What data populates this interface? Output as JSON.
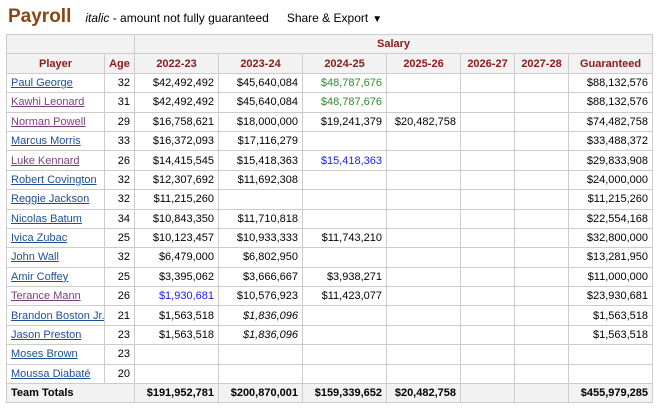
{
  "header": {
    "title": "Payroll",
    "note_italic": "italic",
    "note_rest": " - amount not fully guaranteed",
    "share_label": "Share & Export",
    "share_caret": "▼"
  },
  "table": {
    "group_header": "Salary",
    "columns": [
      "Player",
      "Age",
      "2022-23",
      "2023-24",
      "2024-25",
      "2025-26",
      "2026-27",
      "2027-28",
      "Guaranteed"
    ],
    "rows": [
      {
        "player": "Paul George",
        "visited": false,
        "age": "32",
        "c": [
          {
            "v": "$42,492,492"
          },
          {
            "v": "$45,640,084"
          },
          {
            "v": "$48,787,676",
            "s": "green"
          },
          {
            "v": ""
          },
          {
            "v": ""
          },
          {
            "v": ""
          }
        ],
        "guaranteed": "$88,132,576"
      },
      {
        "player": "Kawhi Leonard",
        "visited": true,
        "age": "31",
        "c": [
          {
            "v": "$42,492,492"
          },
          {
            "v": "$45,640,084"
          },
          {
            "v": "$48,787,676",
            "s": "green"
          },
          {
            "v": ""
          },
          {
            "v": ""
          },
          {
            "v": ""
          }
        ],
        "guaranteed": "$88,132,576"
      },
      {
        "player": "Norman Powell",
        "visited": true,
        "age": "29",
        "c": [
          {
            "v": "$16,758,621"
          },
          {
            "v": "$18,000,000"
          },
          {
            "v": "$19,241,379"
          },
          {
            "v": "$20,482,758"
          },
          {
            "v": ""
          },
          {
            "v": ""
          }
        ],
        "guaranteed": "$74,482,758"
      },
      {
        "player": "Marcus Morris",
        "visited": false,
        "age": "33",
        "c": [
          {
            "v": "$16,372,093"
          },
          {
            "v": "$17,116,279"
          },
          {
            "v": ""
          },
          {
            "v": ""
          },
          {
            "v": ""
          },
          {
            "v": ""
          }
        ],
        "guaranteed": "$33,488,372"
      },
      {
        "player": "Luke Kennard",
        "visited": true,
        "age": "26",
        "c": [
          {
            "v": "$14,415,545"
          },
          {
            "v": "$15,418,363"
          },
          {
            "v": "$15,418,363",
            "s": "blue"
          },
          {
            "v": ""
          },
          {
            "v": ""
          },
          {
            "v": ""
          }
        ],
        "guaranteed": "$29,833,908"
      },
      {
        "player": "Robert Covington",
        "visited": false,
        "age": "32",
        "c": [
          {
            "v": "$12,307,692"
          },
          {
            "v": "$11,692,308"
          },
          {
            "v": ""
          },
          {
            "v": ""
          },
          {
            "v": ""
          },
          {
            "v": ""
          }
        ],
        "guaranteed": "$24,000,000"
      },
      {
        "player": "Reggie Jackson",
        "visited": false,
        "age": "32",
        "c": [
          {
            "v": "$11,215,260"
          },
          {
            "v": ""
          },
          {
            "v": ""
          },
          {
            "v": ""
          },
          {
            "v": ""
          },
          {
            "v": ""
          }
        ],
        "guaranteed": "$11,215,260"
      },
      {
        "player": "Nicolas Batum",
        "visited": false,
        "age": "34",
        "c": [
          {
            "v": "$10,843,350"
          },
          {
            "v": "$11,710,818"
          },
          {
            "v": ""
          },
          {
            "v": ""
          },
          {
            "v": ""
          },
          {
            "v": ""
          }
        ],
        "guaranteed": "$22,554,168"
      },
      {
        "player": "Ivica Zubac",
        "visited": false,
        "age": "25",
        "c": [
          {
            "v": "$10,123,457"
          },
          {
            "v": "$10,933,333"
          },
          {
            "v": "$11,743,210"
          },
          {
            "v": ""
          },
          {
            "v": ""
          },
          {
            "v": ""
          }
        ],
        "guaranteed": "$32,800,000"
      },
      {
        "player": "John Wall",
        "visited": false,
        "age": "32",
        "c": [
          {
            "v": "$6,479,000"
          },
          {
            "v": "$6,802,950"
          },
          {
            "v": ""
          },
          {
            "v": ""
          },
          {
            "v": ""
          },
          {
            "v": ""
          }
        ],
        "guaranteed": "$13,281,950"
      },
      {
        "player": "Amir Coffey",
        "visited": false,
        "age": "25",
        "c": [
          {
            "v": "$3,395,062"
          },
          {
            "v": "$3,666,667"
          },
          {
            "v": "$3,938,271"
          },
          {
            "v": ""
          },
          {
            "v": ""
          },
          {
            "v": ""
          }
        ],
        "guaranteed": "$11,000,000"
      },
      {
        "player": "Terance Mann",
        "visited": true,
        "age": "26",
        "c": [
          {
            "v": "$1,930,681",
            "s": "blue"
          },
          {
            "v": "$10,576,923"
          },
          {
            "v": "$11,423,077"
          },
          {
            "v": ""
          },
          {
            "v": ""
          },
          {
            "v": ""
          }
        ],
        "guaranteed": "$23,930,681"
      },
      {
        "player": "Brandon Boston Jr.",
        "visited": false,
        "age": "21",
        "c": [
          {
            "v": "$1,563,518"
          },
          {
            "v": "$1,836,096",
            "s": "italic"
          },
          {
            "v": ""
          },
          {
            "v": ""
          },
          {
            "v": ""
          },
          {
            "v": ""
          }
        ],
        "guaranteed": "$1,563,518"
      },
      {
        "player": "Jason Preston",
        "visited": false,
        "age": "23",
        "c": [
          {
            "v": "$1,563,518"
          },
          {
            "v": "$1,836,096",
            "s": "italic"
          },
          {
            "v": ""
          },
          {
            "v": ""
          },
          {
            "v": ""
          },
          {
            "v": ""
          }
        ],
        "guaranteed": "$1,563,518"
      },
      {
        "player": "Moses Brown",
        "visited": false,
        "age": "23",
        "c": [
          {
            "v": ""
          },
          {
            "v": ""
          },
          {
            "v": ""
          },
          {
            "v": ""
          },
          {
            "v": ""
          },
          {
            "v": ""
          }
        ],
        "guaranteed": ""
      },
      {
        "player": "Moussa Diabaté",
        "visited": false,
        "age": "20",
        "c": [
          {
            "v": ""
          },
          {
            "v": ""
          },
          {
            "v": ""
          },
          {
            "v": ""
          },
          {
            "v": ""
          },
          {
            "v": ""
          }
        ],
        "guaranteed": ""
      }
    ],
    "totals": {
      "label": "Team Totals",
      "values": [
        "$191,952,781",
        "$200,870,001",
        "$159,339,652",
        "$20,482,758",
        "",
        ""
      ],
      "guaranteed": "$455,979,285"
    }
  },
  "colors": {
    "title": "#8b4513",
    "header_text": "#8b1a1a",
    "link": "#1f4e96",
    "link_visited": "#7b3f7b",
    "green_option": "#2e8b2e",
    "blue_option": "#1a1aff"
  }
}
